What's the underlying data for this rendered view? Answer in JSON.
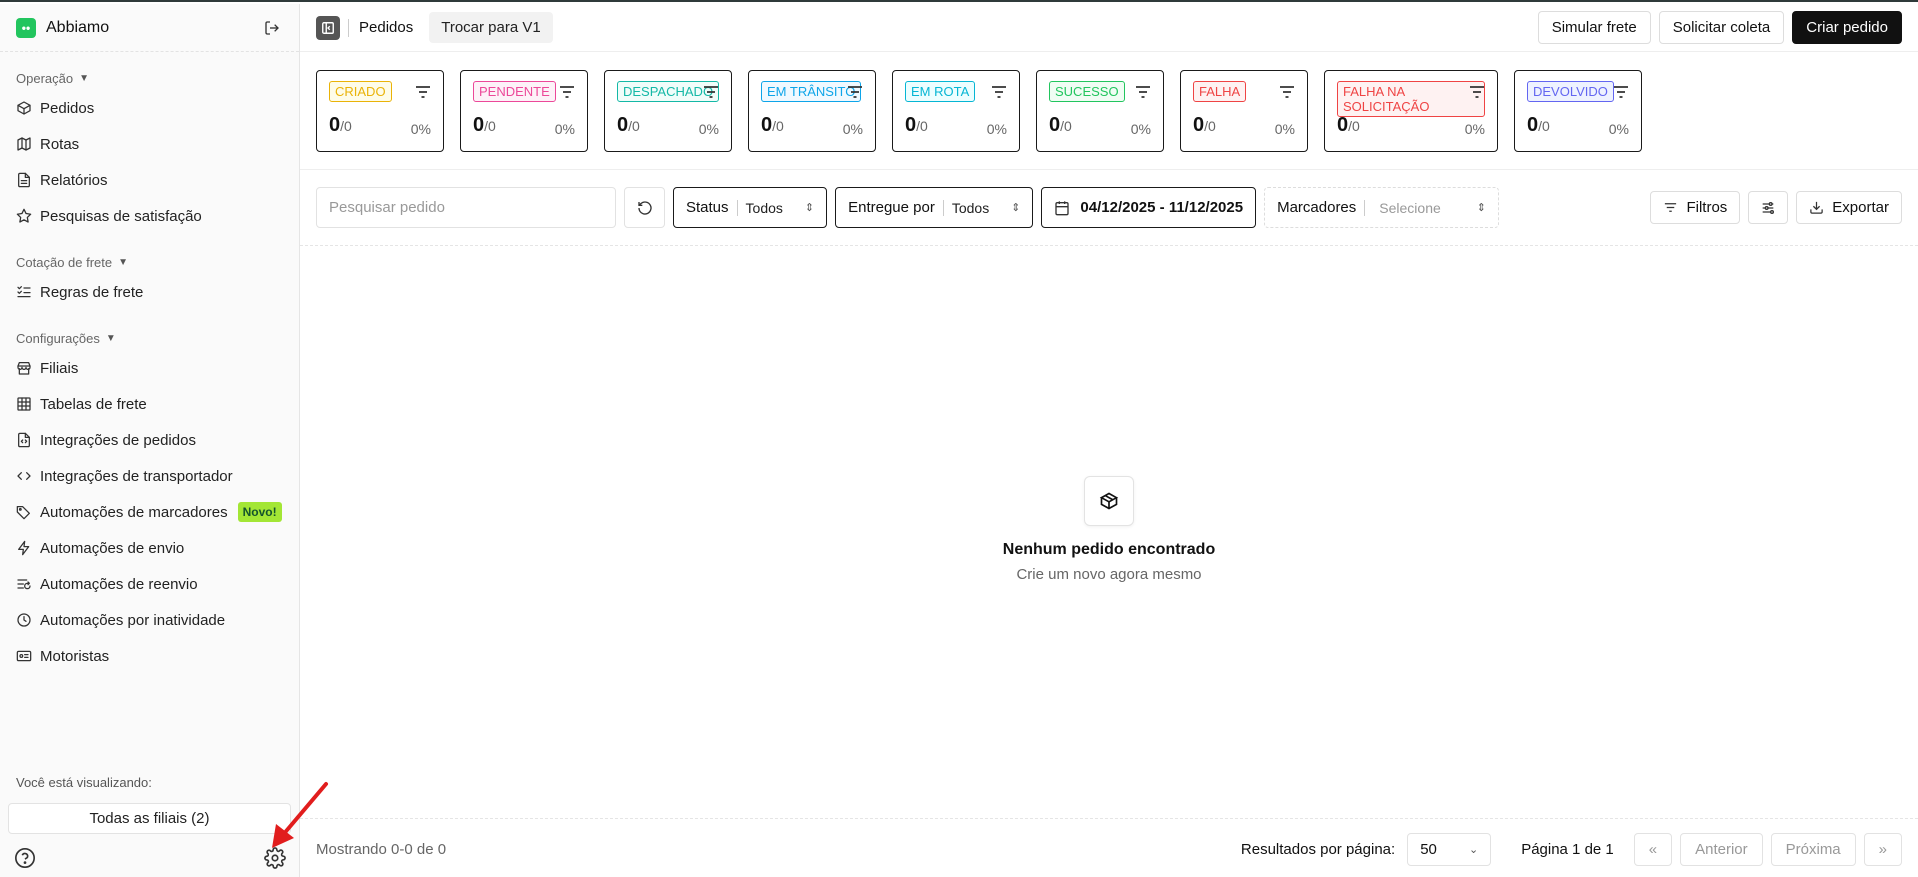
{
  "sidebar": {
    "brand": {
      "logo_text": "••",
      "name": "Abbiamo"
    },
    "sections": [
      {
        "title": "Operação",
        "items": [
          {
            "label": "Pedidos",
            "icon": "box-icon"
          },
          {
            "label": "Rotas",
            "icon": "map-icon"
          },
          {
            "label": "Relatórios",
            "icon": "file-icon"
          },
          {
            "label": "Pesquisas de satisfação",
            "icon": "star-icon"
          }
        ]
      },
      {
        "title": "Cotação de frete",
        "items": [
          {
            "label": "Regras de frete",
            "icon": "list-checks-icon"
          }
        ]
      },
      {
        "title": "Configurações",
        "items": [
          {
            "label": "Filiais",
            "icon": "store-icon"
          },
          {
            "label": "Tabelas de frete",
            "icon": "table-icon"
          },
          {
            "label": "Integrações de pedidos",
            "icon": "file-code-icon"
          },
          {
            "label": "Integrações de transportador",
            "icon": "code-icon"
          },
          {
            "label": "Automações de marcadores",
            "icon": "tags-icon",
            "badge": "Novo!"
          },
          {
            "label": "Automações de envio",
            "icon": "zap-icon"
          },
          {
            "label": "Automações de reenvio",
            "icon": "list-restart-icon"
          },
          {
            "label": "Automações por inatividade",
            "icon": "clock-icon"
          },
          {
            "label": "Motoristas",
            "icon": "id-card-icon"
          }
        ]
      }
    ],
    "viewing_label": "Você está visualizando:",
    "branch_select": "Todas as filiais (2)"
  },
  "topbar": {
    "page_title": "Pedidos",
    "switch_label": "Trocar para V1",
    "simulate_label": "Simular frete",
    "request_label": "Solicitar coleta",
    "create_label": "Criar pedido"
  },
  "status_cards": [
    {
      "label": "CRIADO",
      "count": "0",
      "total": "/0",
      "percent": "0%",
      "color": "#eab308",
      "bg": "#fefce8"
    },
    {
      "label": "PENDENTE",
      "count": "0",
      "total": "/0",
      "percent": "0%",
      "color": "#ec4899",
      "bg": "#fdf2f8"
    },
    {
      "label": "DESPACHADO",
      "count": "0",
      "total": "/0",
      "percent": "0%",
      "color": "#14b8a6",
      "bg": "#f0fdfa"
    },
    {
      "label": "EM TRÂNSITO",
      "count": "0",
      "total": "/0",
      "percent": "0%",
      "color": "#0ea5e9",
      "bg": "#f0f9ff"
    },
    {
      "label": "EM ROTA",
      "count": "0",
      "total": "/0",
      "percent": "0%",
      "color": "#06b6d4",
      "bg": "#ecfeff"
    },
    {
      "label": "SUCESSO",
      "count": "0",
      "total": "/0",
      "percent": "0%",
      "color": "#22c55e",
      "bg": "#f0fdf4"
    },
    {
      "label": "FALHA",
      "count": "0",
      "total": "/0",
      "percent": "0%",
      "color": "#ef4444",
      "bg": "#fef2f2"
    },
    {
      "label": "FALHA NA SOLICITAÇÃO",
      "count": "0",
      "total": "/0",
      "percent": "0%",
      "color": "#ef4444",
      "bg": "#fef2f2"
    },
    {
      "label": "DEVOLVIDO",
      "count": "0",
      "total": "/0",
      "percent": "0%",
      "color": "#6366f1",
      "bg": "#eef2ff"
    }
  ],
  "filters": {
    "search_placeholder": "Pesquisar pedido",
    "status_label": "Status",
    "status_value": "Todos",
    "delivered_label": "Entregue por",
    "delivered_value": "Todos",
    "date_range": "04/12/2025 - 11/12/2025",
    "markers_label": "Marcadores",
    "markers_value": "Selecione",
    "filters_label": "Filtros",
    "export_label": "Exportar"
  },
  "empty_state": {
    "title": "Nenhum pedido encontrado",
    "subtitle": "Crie um novo agora mesmo"
  },
  "footer": {
    "showing": "Mostrando 0-0 de 0",
    "per_page_label": "Resultados por página:",
    "per_page_value": "50",
    "page_info": "Página 1 de 1",
    "first": "«",
    "prev": "Anterior",
    "next": "Próxima",
    "last": "»"
  },
  "colors": {
    "annotation_arrow": "#e11d1d"
  }
}
